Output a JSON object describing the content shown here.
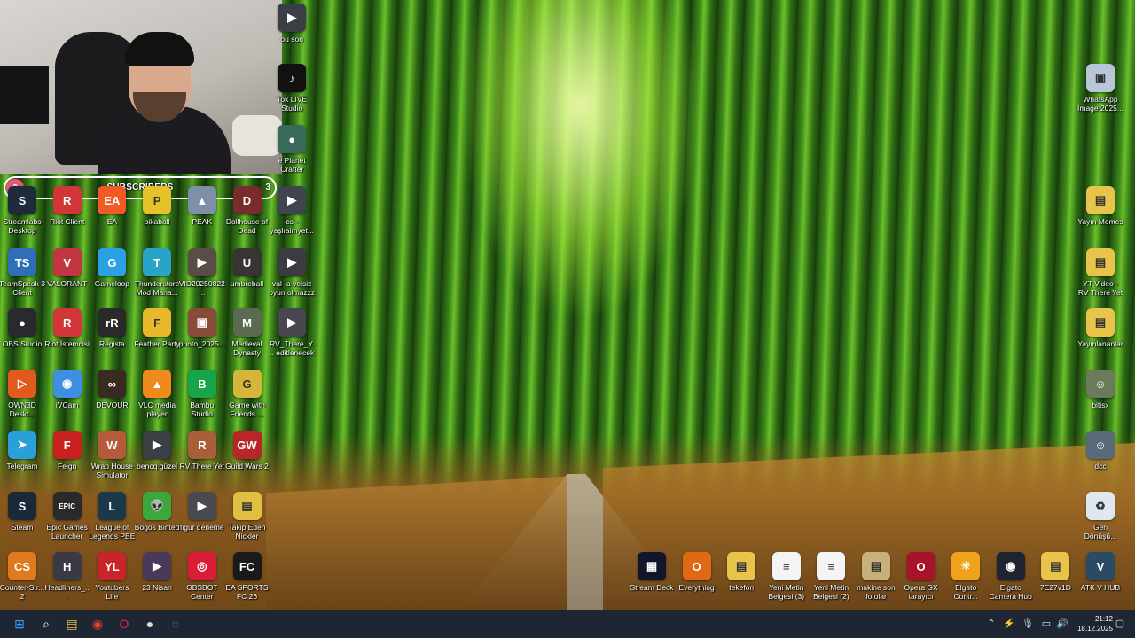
{
  "webcam": {
    "subscribers": {
      "count": "0",
      "label": "SUBSCRIBERS",
      "goal": "3"
    }
  },
  "icons": [
    {
      "label": "Streamlabs Desktop",
      "color": "#1d2b3a",
      "glyph": "S",
      "col": 0,
      "row": 0
    },
    {
      "label": "Riot Client",
      "color": "#d13639",
      "glyph": "R",
      "col": 1,
      "row": 0
    },
    {
      "label": "EA",
      "color": "#f15a24",
      "glyph": "EA",
      "col": 2,
      "row": 0
    },
    {
      "label": "pikaball",
      "color": "#e6c229",
      "glyph": "P",
      "col": 3,
      "row": 0
    },
    {
      "label": "PEAK",
      "color": "#7f8fa8",
      "glyph": "▲",
      "col": 4,
      "row": 0
    },
    {
      "label": "Dollhouse of Dead",
      "color": "#7a2b2b",
      "glyph": "D",
      "col": 5,
      "row": 0
    },
    {
      "label": "cs - yaşlıaimyet...",
      "color": "#40444c",
      "glyph": "▶",
      "col": 6,
      "row": 0
    },
    {
      "label": "TeamSpeak 3 Client",
      "color": "#2f6fb8",
      "glyph": "TS",
      "col": 0,
      "row": 1
    },
    {
      "label": "VALORANT",
      "color": "#c23642",
      "glyph": "V",
      "col": 1,
      "row": 1
    },
    {
      "label": "Gameloop",
      "color": "#2aa1e3",
      "glyph": "G",
      "col": 2,
      "row": 1
    },
    {
      "label": "Thunderstore Mod Mana...",
      "color": "#29a4c9",
      "glyph": "T",
      "col": 3,
      "row": 1
    },
    {
      "label": "VID20250822...",
      "color": "#5a4c46",
      "glyph": "▶",
      "col": 4,
      "row": 1
    },
    {
      "label": "umbreball",
      "color": "#3a3334",
      "glyph": "U",
      "col": 5,
      "row": 1
    },
    {
      "label": "val -a velsiz oyun olmazzz",
      "color": "#3d3a41",
      "glyph": "▶",
      "col": 6,
      "row": 1
    },
    {
      "label": "OBS Studio",
      "color": "#2a2a2e",
      "glyph": "●",
      "col": 0,
      "row": 2
    },
    {
      "label": "Riot İstemcisi",
      "color": "#d13639",
      "glyph": "R",
      "col": 1,
      "row": 2
    },
    {
      "label": "Regista",
      "color": "#2a2a2a",
      "glyph": "rR",
      "col": 2,
      "row": 2
    },
    {
      "label": "Feather Party",
      "color": "#e8b92a",
      "glyph": "F",
      "col": 3,
      "row": 2
    },
    {
      "label": "photo_2025...",
      "color": "#8a4a3a",
      "glyph": "▣",
      "col": 4,
      "row": 2
    },
    {
      "label": "Medieval Dynasty",
      "color": "#5c6a52",
      "glyph": "M",
      "col": 5,
      "row": 2
    },
    {
      "label": "RV_There_Y... editlenecek",
      "color": "#4a4650",
      "glyph": "▶",
      "col": 6,
      "row": 2
    },
    {
      "label": "OWN3D Deskt...",
      "color": "#e05a1e",
      "glyph": "▷",
      "col": 0,
      "row": 3
    },
    {
      "label": "iVCam",
      "color": "#3f8fe0",
      "glyph": "◉",
      "col": 1,
      "row": 3
    },
    {
      "label": "DEVOUR",
      "color": "#3a2a22",
      "glyph": "∞",
      "col": 2,
      "row": 3
    },
    {
      "label": "VLC media player",
      "color": "#f08a1c",
      "glyph": "▲",
      "col": 3,
      "row": 3
    },
    {
      "label": "Bambu Studio",
      "color": "#18a448",
      "glyph": "B",
      "col": 4,
      "row": 3
    },
    {
      "label": "Game with Friends ...",
      "color": "#d6b63a",
      "glyph": "G",
      "col": 5,
      "row": 3
    },
    {
      "label": "Telegram",
      "color": "#2a9fd8",
      "glyph": "➤",
      "col": 0,
      "row": 4
    },
    {
      "label": "Feign",
      "color": "#c8201e",
      "glyph": "F",
      "col": 1,
      "row": 4
    },
    {
      "label": "Wrap House Simulator",
      "color": "#b55a3a",
      "glyph": "W",
      "col": 2,
      "row": 4
    },
    {
      "label": "bencq güzel",
      "color": "#3a3f46",
      "glyph": "▶",
      "col": 3,
      "row": 4
    },
    {
      "label": "RV There Yet",
      "color": "#a8603a",
      "glyph": "R",
      "col": 4,
      "row": 4
    },
    {
      "label": "Guild Wars 2",
      "color": "#b8262a",
      "glyph": "GW",
      "col": 5,
      "row": 4
    },
    {
      "label": "Steam",
      "color": "#1b2838",
      "glyph": "S",
      "col": 0,
      "row": 5
    },
    {
      "label": "Epic Games Launcher",
      "color": "#2a2a2a",
      "glyph": "EPIC",
      "col": 1,
      "row": 5
    },
    {
      "label": "League of Legends PBE",
      "color": "#1a3a4a",
      "glyph": "L",
      "col": 2,
      "row": 5
    },
    {
      "label": "Bogos Binted",
      "color": "#3aa83a",
      "glyph": "👽",
      "col": 3,
      "row": 5
    },
    {
      "label": "figur deneme",
      "color": "#4a4a52",
      "glyph": "▶",
      "col": 4,
      "row": 5
    },
    {
      "label": "Takip Eden Nickler",
      "color": "#e0c040",
      "glyph": "▤",
      "col": 5,
      "row": 5
    },
    {
      "label": "Counter-Str... 2",
      "color": "#e07a1e",
      "glyph": "CS",
      "col": 0,
      "row": 6
    },
    {
      "label": "Headliners_...",
      "color": "#3a3a44",
      "glyph": "H",
      "col": 1,
      "row": 6
    },
    {
      "label": "Youtubers Life",
      "color": "#c8242a",
      "glyph": "YL",
      "col": 2,
      "row": 6
    },
    {
      "label": "23 Nisan",
      "color": "#4a3a5a",
      "glyph": "▶",
      "col": 3,
      "row": 6
    },
    {
      "label": "OBSBOT Center",
      "color": "#d81e36",
      "glyph": "◎",
      "col": 4,
      "row": 6
    },
    {
      "label": "EA SPORTS FC 26",
      "color": "#1a1a1a",
      "glyph": "FC",
      "col": 5,
      "row": 6
    },
    {
      "label": "Stream Deck",
      "color": "#12162a",
      "glyph": "▦",
      "col": 14,
      "row": 6
    },
    {
      "label": "Everything",
      "color": "#e06a14",
      "glyph": "O",
      "col": 15,
      "row": 6
    },
    {
      "label": "tekefon",
      "color": "#e8c44a",
      "glyph": "▤",
      "col": 16,
      "row": 6
    },
    {
      "label": "Yeni Metin Belgesi (3)",
      "color": "#f4f4f4",
      "glyph": "≡",
      "col": 17,
      "row": 6
    },
    {
      "label": "Yeni Metin Belgesi (2)",
      "color": "#f4f4f4",
      "glyph": "≡",
      "col": 18,
      "row": 6
    },
    {
      "label": "makine son fotolar",
      "color": "#c9b07a",
      "glyph": "▤",
      "col": 19,
      "row": 6
    },
    {
      "label": "Opera GX tarayıcı",
      "color": "#a8122a",
      "glyph": "O",
      "col": 20,
      "row": 6
    },
    {
      "label": "Elgato Contr...",
      "color": "#f0a21a",
      "glyph": "☀",
      "col": 21,
      "row": 6
    },
    {
      "label": "Elgato Camera Hub",
      "color": "#1e2430",
      "glyph": "◉",
      "col": 22,
      "row": 6
    },
    {
      "label": "7E27v1D",
      "color": "#e8c44a",
      "glyph": "▤",
      "col": 23,
      "row": 6
    },
    {
      "label": "ATK V HUB",
      "color": "#2a4a66",
      "glyph": "V",
      "col": 24,
      "row": 6
    },
    {
      "label": "WhatsApp Image 2025...",
      "color": "#b8c6d8",
      "glyph": "▣",
      "col": 24,
      "row": "w"
    },
    {
      "label": "Yayın Memes",
      "color": "#e8c44a",
      "glyph": "▤",
      "col": 24,
      "row": "m"
    },
    {
      "label": "YT Video - RV There Yet",
      "color": "#e8c44a",
      "glyph": "▤",
      "col": 24,
      "row": "y"
    },
    {
      "label": "Yayınlananlar",
      "color": "#e8c44a",
      "glyph": "▤",
      "col": 24,
      "row": "p"
    },
    {
      "label": "bitisx",
      "color": "#6a7a5a",
      "glyph": "☺",
      "col": 24,
      "row": "b"
    },
    {
      "label": "dcc",
      "color": "#5a6a7a",
      "glyph": "☺",
      "col": 24,
      "row": "d"
    },
    {
      "label": "Geri Dönüşü...",
      "color": "#dfe8f0",
      "glyph": "♻",
      "col": 24,
      "row": "r"
    },
    {
      "label": "ou son",
      "color": "#3a3f46",
      "glyph": "▶",
      "col": 6,
      "row": "t0"
    },
    {
      "label": "Tok LIVE Studio",
      "color": "#111",
      "glyph": "♪",
      "col": 6,
      "row": "t1"
    },
    {
      "label": "e Planet Crafter",
      "color": "#3a6a5a",
      "glyph": "●",
      "col": 6,
      "row": "t2"
    }
  ],
  "taskbar": {
    "apps": [
      {
        "name": "windows-start-icon",
        "glyph": "⊞",
        "color": "#3aa0ff"
      },
      {
        "name": "search-icon",
        "glyph": "⌕",
        "color": "#ffffff"
      },
      {
        "name": "file-explorer-icon",
        "glyph": "▤",
        "color": "#e8c44a"
      },
      {
        "name": "chrome-icon",
        "glyph": "◉",
        "color": "#e4412c"
      },
      {
        "name": "opera-icon",
        "glyph": "O",
        "color": "#e8204a"
      },
      {
        "name": "obs-icon",
        "glyph": "●",
        "color": "#d8d8d8"
      },
      {
        "name": "app-icon",
        "glyph": "◌",
        "color": "#4aa8ff"
      }
    ],
    "clock": {
      "time": "21:12",
      "date": "18.12.2025"
    }
  }
}
